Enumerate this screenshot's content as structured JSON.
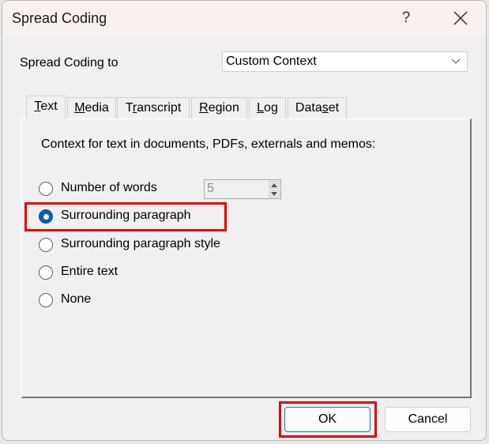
{
  "dialog": {
    "title": "Spread Coding",
    "help_label": "?",
    "close_icon": "close-icon"
  },
  "spread": {
    "label": "Spread Coding to",
    "selected": "Custom Context",
    "dropdown_icon": "chevron-down-icon"
  },
  "tabs": [
    {
      "label": "Text",
      "mnemonic": "T",
      "active": true
    },
    {
      "label": "Media",
      "mnemonic": "M",
      "active": false
    },
    {
      "label": "Transcript",
      "mnemonic": "r",
      "active": false
    },
    {
      "label": "Region",
      "mnemonic": "R",
      "active": false
    },
    {
      "label": "Log",
      "mnemonic": "L",
      "active": false
    },
    {
      "label": "Dataset",
      "mnemonic": "s",
      "active": false
    }
  ],
  "panel": {
    "description": "Context for text in documents, PDFs, externals and memos:",
    "options": [
      {
        "label": "Number of words",
        "checked": false
      },
      {
        "label": "Surrounding paragraph",
        "checked": true
      },
      {
        "label": "Surrounding paragraph style",
        "checked": false
      },
      {
        "label": "Entire text",
        "checked": false
      },
      {
        "label": "None",
        "checked": false
      }
    ],
    "words_count": "5"
  },
  "buttons": {
    "ok": "OK",
    "cancel": "Cancel"
  },
  "colors": {
    "highlight": "#e60000",
    "radio_checked": "#0a5bb5",
    "titlebar": "#f9f1ee"
  }
}
